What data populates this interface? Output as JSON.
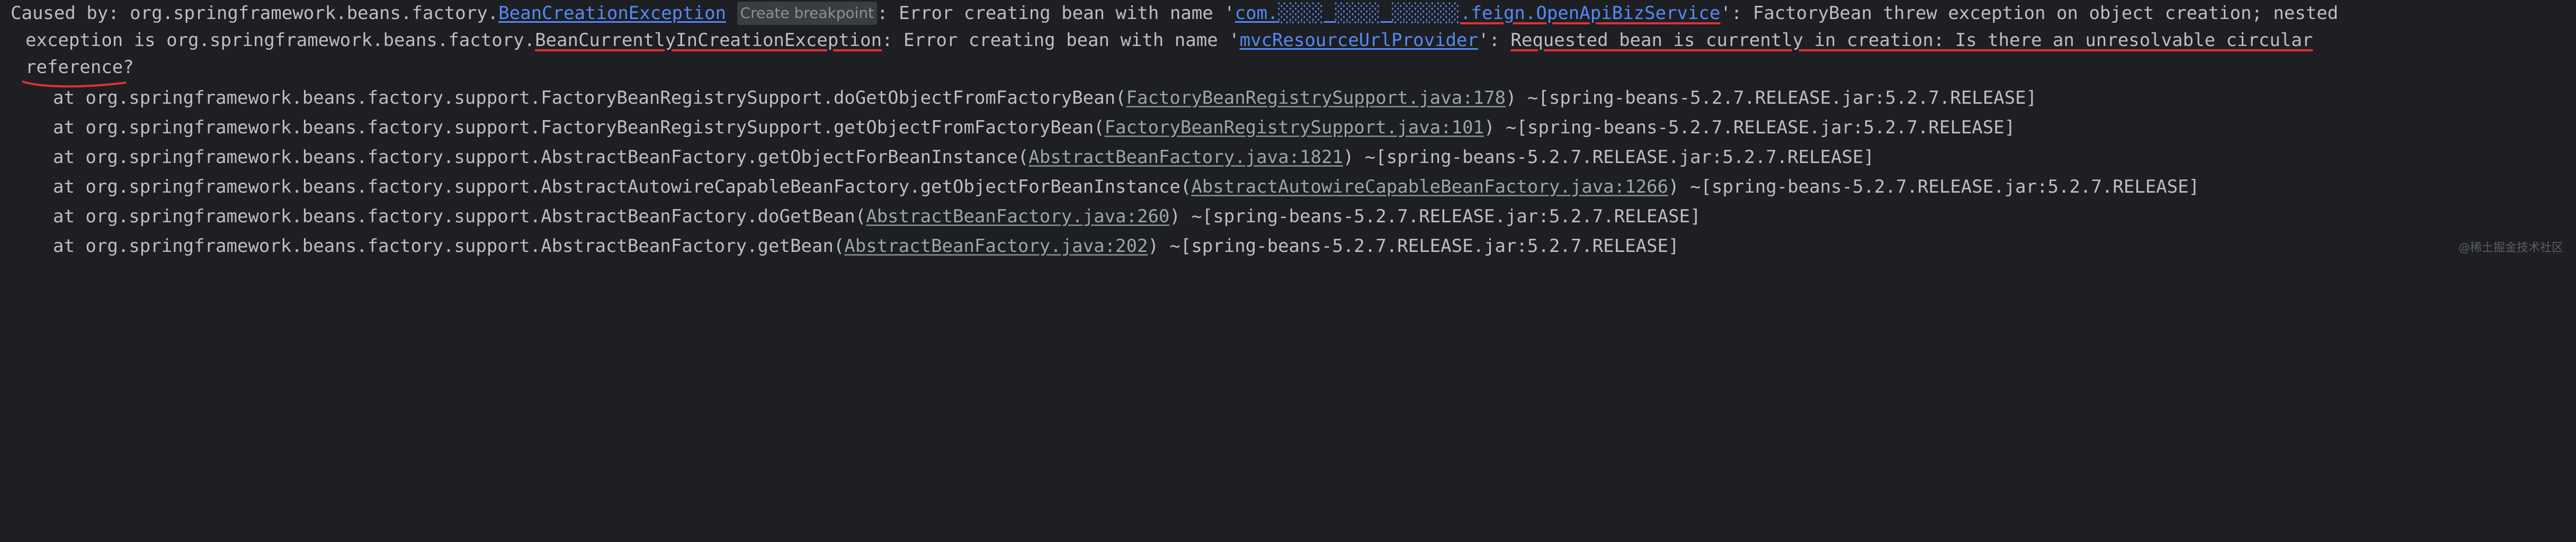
{
  "console": {
    "caused_by_prefix": "Caused by: ",
    "pkg1": "org.springframework.beans.factory.",
    "exc1": "BeanCreationException",
    "bp_hint": "Create breakpoint",
    "msg1_a": ": Error creating bean with name '",
    "bean1_a": "com.",
    "bean1_b": "░░░░ ░░░░ ░░░░░░",
    "bean1_c": ".feign.OpenApiBizService",
    "msg1_b": "': FactoryBean threw exception on object creation; nested",
    "line2_a": "exception is org.springframework.beans.factory.",
    "exc2": "BeanCurrentlyInCreationException",
    "line2_b": ": Error creating bean with name '",
    "bean2": "mvcResourceUrlProvider",
    "line2_c": "': ",
    "line2_red": "Requested bean is currently in creation: Is there an unresolvable circular",
    "line3": "reference?",
    "frames": [
      {
        "at": "at org.springframework.beans.factory.support.FactoryBeanRegistrySupport.doGetObjectFromFactoryBean(",
        "src": "FactoryBeanRegistrySupport.java:178",
        "tail": ") ~[spring-beans-5.2.7.RELEASE.jar:5.2.7.RELEASE]"
      },
      {
        "at": "at org.springframework.beans.factory.support.FactoryBeanRegistrySupport.getObjectFromFactoryBean(",
        "src": "FactoryBeanRegistrySupport.java:101",
        "tail": ") ~[spring-beans-5.2.7.RELEASE.jar:5.2.7.RELEASE]"
      },
      {
        "at": "at org.springframework.beans.factory.support.AbstractBeanFactory.getObjectForBeanInstance(",
        "src": "AbstractBeanFactory.java:1821",
        "tail": ") ~[spring-beans-5.2.7.RELEASE.jar:5.2.7.RELEASE]"
      },
      {
        "at": "at org.springframework.beans.factory.support.AbstractAutowireCapableBeanFactory.getObjectForBeanInstance(",
        "src": "AbstractAutowireCapableBeanFactory.java:1266",
        "tail": ") ~[spring-beans-5.2.7.RELEASE.jar:5.2.7.RELEASE]"
      },
      {
        "at": "at org.springframework.beans.factory.support.AbstractBeanFactory.doGetBean(",
        "src": "AbstractBeanFactory.java:260",
        "tail": ") ~[spring-beans-5.2.7.RELEASE.jar:5.2.7.RELEASE]"
      },
      {
        "at": "at org.springframework.beans.factory.support.AbstractBeanFactory.getBean(",
        "src": "AbstractBeanFactory.java:202",
        "tail": ") ~[spring-beans-5.2.7.RELEASE.jar:5.2.7.RELEASE]"
      }
    ],
    "watermark": "@稀土掘金技术社区"
  },
  "colors": {
    "background": "#1e1f22",
    "text": "#bcbec4",
    "link": "#548af7",
    "annotation_red": "#e0303a"
  }
}
